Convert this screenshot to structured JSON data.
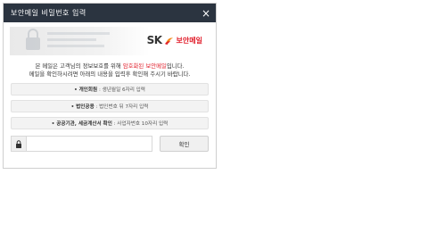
{
  "window": {
    "title": "보안메일 비밀번호 입력",
    "close_label": "×"
  },
  "banner": {
    "brand_prefix": "SK",
    "brand_name": "보안메일"
  },
  "notice": {
    "line1_a": "본 메일은 고객님의 정보보호를 위해 ",
    "line1_highlight": "암호화된 보안메일",
    "line1_b": "입니다.",
    "line2": "메일을 확인하시려면 아래의 내용을 입력후 확인해 주시기 바랍니다."
  },
  "info_rows": [
    {
      "label": "• 개인회원",
      "desc": " : 생년월일 6자리 입력"
    },
    {
      "label": "• 법인공용",
      "desc": " : 법인번호 뒤 7자리 입력"
    },
    {
      "label": "• 공공기관, 세금계산서 확인",
      "desc": " : 사업자번호 10자리 입력"
    }
  ],
  "password": {
    "value": "",
    "placeholder": ""
  },
  "confirm_label": "확인",
  "colors": {
    "titlebar": "#2b3440",
    "accent": "#e11d2a"
  },
  "icons": {
    "lock": "lock-icon",
    "close": "close-icon",
    "brand": "sk-logo-icon"
  }
}
